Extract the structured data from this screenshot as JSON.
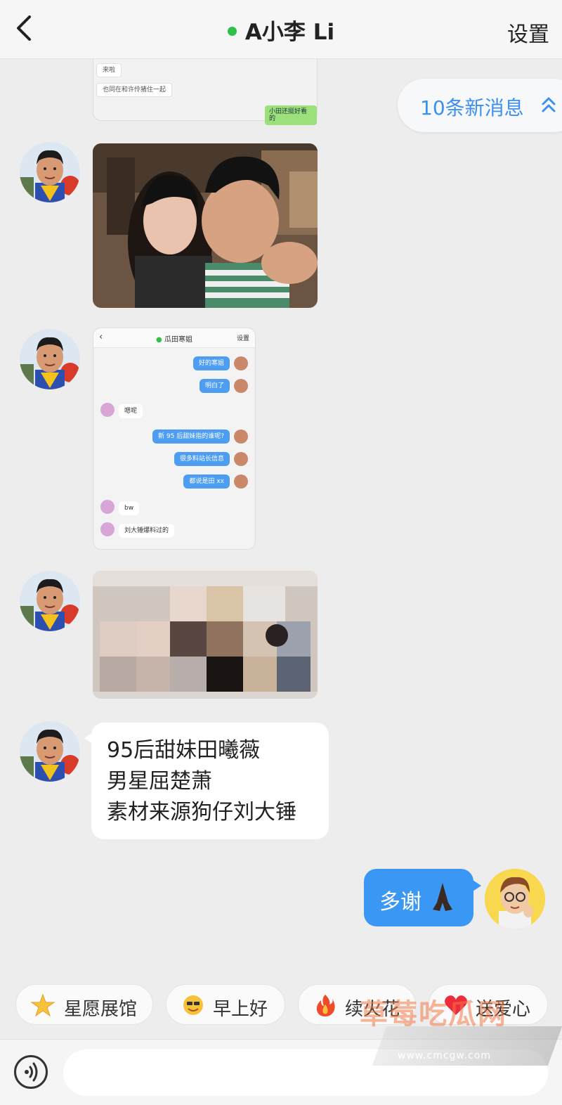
{
  "header": {
    "title": "A小李 Li",
    "settings_label": "设置"
  },
  "new_messages": {
    "label": "10条新消息"
  },
  "shot0": {
    "msg1": "来啦",
    "msg2": "也同在和许伶猪住一起",
    "msg3": "小田还挺好看的"
  },
  "shot2": {
    "title": "瓜田寒姐",
    "settings": "设置",
    "messages": [
      {
        "side": "right",
        "text": "好的寒姐"
      },
      {
        "side": "right",
        "text": "明白了"
      },
      {
        "side": "left",
        "text": "嗯呢"
      },
      {
        "side": "right",
        "text": "新 95 后甜妹指的谁呢?"
      },
      {
        "side": "right",
        "text": "很多料站长信息"
      },
      {
        "side": "right",
        "text": "都说是田 xx"
      },
      {
        "side": "left",
        "text": "bw"
      },
      {
        "side": "left",
        "text": "刘大锤爆料过的"
      }
    ]
  },
  "text_message": {
    "lines": [
      "95后甜妹田曦薇",
      "男星屈楚萧",
      "素材来源狗仔刘大锤"
    ]
  },
  "my_message": {
    "text": "多谢"
  },
  "quick_replies": [
    {
      "label": "星愿展馆",
      "icon": "star-icon"
    },
    {
      "label": "早上好",
      "icon": "sun-face-icon"
    },
    {
      "label": "续火花",
      "icon": "fire-icon"
    },
    {
      "label": "送爱心",
      "icon": "heart-icon"
    }
  ],
  "watermark": {
    "text": "草莓吃瓜网",
    "url": "www.cmcgw.com"
  },
  "colors": {
    "accent": "#3b97f4",
    "online": "#2ec24a",
    "pill_text": "#3d8ff0"
  }
}
